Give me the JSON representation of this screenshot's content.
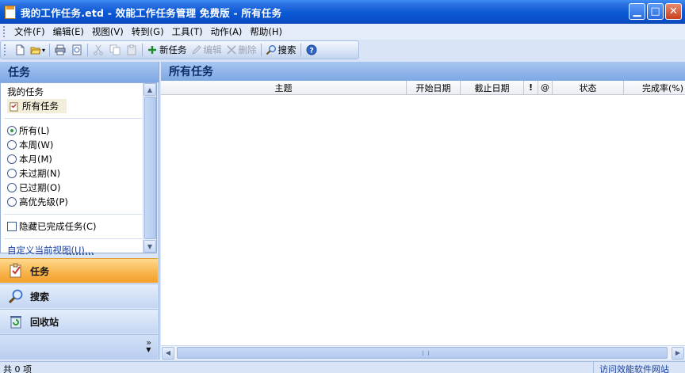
{
  "window": {
    "title": "我的工作任务.etd - 效能工作任务管理 免费版 - 所有任务",
    "min_glyph": "▁",
    "max_glyph": "□",
    "close_glyph": "✕"
  },
  "menu": [
    "文件(F)",
    "编辑(E)",
    "视图(V)",
    "转到(G)",
    "工具(T)",
    "动作(A)",
    "帮助(H)"
  ],
  "toolbar": {
    "new_task": "新任务",
    "edit": "编辑",
    "delete": "删除",
    "search": "搜索"
  },
  "left_pane": {
    "header": "任务",
    "section_title": "我的任务",
    "all_tasks": "所有任务",
    "filters": [
      "所有(L)",
      "本周(W)",
      "本月(M)",
      "未过期(N)",
      "已过期(O)",
      "高优先级(P)"
    ],
    "selected_filter_index": 0,
    "hide_completed": "隐藏已完成任务(C)",
    "hide_completed_checked": false,
    "custom_view": "自定义当前视图(U)..."
  },
  "nav": {
    "tasks": "任务",
    "search": "搜索",
    "recycle": "回收站",
    "active": "tasks",
    "more_glyph": "»"
  },
  "right_pane": {
    "header": "所有任务",
    "columns": [
      "主题",
      "开始日期",
      "截止日期",
      "!",
      "@",
      "状态",
      "完成率(%)"
    ]
  },
  "status": {
    "count": "共 0 项",
    "visit_link": "访问效能软件网站"
  },
  "colors": {
    "title_blue": "#0a58d4",
    "active_nav": "#f7b34b",
    "pane_header": "#7ea7e3"
  }
}
